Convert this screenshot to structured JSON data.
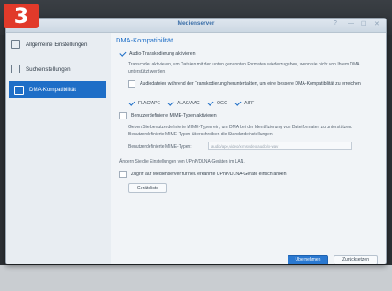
{
  "badge": "3",
  "window": {
    "title": "Medienserver",
    "controls": {
      "help": "?",
      "minimize": "—",
      "maximize": "☐",
      "close": "✕"
    }
  },
  "sidebar": {
    "items": [
      {
        "label": "Allgemeine Einstellungen"
      },
      {
        "label": "Sucheinstellungen"
      },
      {
        "label": "DMA-Kompatibilität"
      }
    ]
  },
  "main": {
    "heading": "DMA-Kompatibilität",
    "audio_transcoding": "Audio-Transkodierung aktivieren",
    "transcoder_desc": "Transcoder aktivieren, um Dateien mit den unten genannten Formaten wiederzugeben, wenn sie nicht von Ihrem DMA unterstützt werden.",
    "downsample_label": "Audiodateien während der Transkodierung heruntertakten, um eine bessere DMA-Kompatibilität zu erreichen",
    "formats": [
      "FLAC/APE",
      "ALAC/AAC",
      "OGG",
      "AIFF"
    ],
    "custom_mime": "Benutzerdefinierte MIME-Typen aktivieren",
    "mime_desc": "Geben Sie benutzerdefinierte MIME-Typen ein, um DMA bei der Identifizierung von Dateiformaten zu unterstützen. Benutzerdefinierte MIME-Typen überschreiben die Standardeinstellungen.",
    "mime_field_label": "Benutzerdefinierte MIME-Typen:",
    "mime_placeholder": "audio/ape,video/x-msvideo,audio/x-wav",
    "upnp_heading": "Ändern Sie die Einstellungen von UPnP/DLNA-Geräten im LAN.",
    "restrict_access": "Zugriff auf Medienserver für neu erkannte UPnP/DLNA-Geräte einschränken",
    "device_list_button": "Geräteliste",
    "apply_button": "Übernehmen",
    "reset_button": "Zurücksetzen"
  },
  "colors": {
    "accent": "#1e6ec7",
    "badge": "#e13a2a"
  }
}
